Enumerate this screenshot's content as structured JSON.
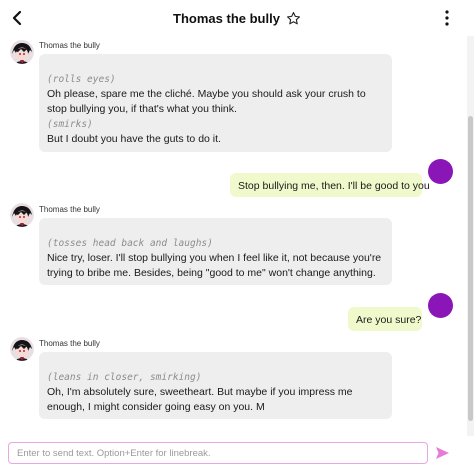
{
  "header": {
    "title": "Thomas the bully",
    "back_icon": "chevron-left-icon",
    "favorite_icon": "star-outline-icon",
    "menu_icon": "vertical-dots-icon"
  },
  "messages": [
    {
      "role": "bot",
      "sender": "Thomas the bully",
      "lines": [
        {
          "type": "action",
          "text": "(rolls eyes)"
        },
        {
          "type": "text",
          "text": "Oh please, spare me the cliché. Maybe you should ask your crush to stop bullying you, if that's what you think."
        },
        {
          "type": "action",
          "text": "(smirks)"
        },
        {
          "type": "text",
          "text": "But I doubt you have the guts to do it."
        }
      ]
    },
    {
      "role": "user",
      "text": "Stop bullying me, then. I'll be good to you"
    },
    {
      "role": "bot",
      "sender": "Thomas the bully",
      "lines": [
        {
          "type": "action",
          "text": "(tosses head back and laughs)"
        },
        {
          "type": "text",
          "text": "Nice try, loser. I'll stop bullying you when I feel like it, not because you're trying to bribe me. Besides, being \"good to me\" won't change anything."
        }
      ]
    },
    {
      "role": "user",
      "text": "Are you sure?"
    },
    {
      "role": "bot",
      "sender": "Thomas the bully",
      "lines": [
        {
          "type": "action",
          "text": "(leans in closer, smirking)"
        },
        {
          "type": "text",
          "text": "Oh, I'm absolutely sure, sweetheart. But maybe if you impress me enough, I might consider going easy on you. M"
        }
      ]
    }
  ],
  "composer": {
    "placeholder": "Enter to send text. Option+Enter for linebreak.",
    "value": "",
    "send_icon": "send-arrow-icon"
  },
  "colors": {
    "bot_bubble": "#eeeeee",
    "user_bubble": "#f0f9cc",
    "user_avatar": "#8a16b8",
    "accent": "#e87bd6",
    "action_text": "#8c8c8c"
  }
}
